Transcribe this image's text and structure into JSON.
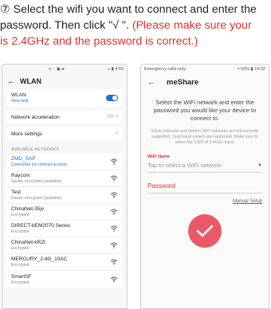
{
  "instruction": {
    "line1": "⑦ Select the wifi you want to connect and enter the",
    "line2_black": "password. Then click \"√ \". ",
    "line2_red": "(Please make sure your",
    "line3_red": "is 2.4GHz and the password is correct.)"
  },
  "left_phone": {
    "status_left": "",
    "status_center": "≡ ∴ ▣ ●",
    "status_right": "◒ ▮ 4:59",
    "title": "WLAN",
    "wlan_label": "WLAN",
    "wlan_link": "View help",
    "network_accel_label": "Network acceleration",
    "network_accel_value": "On >",
    "more_settings_label": "More settings",
    "section_label": "AVAILABLE NETWORKS",
    "networks": [
      {
        "name": "ZMD_SAP",
        "status": "Connected (no Internet access)"
      },
      {
        "name": "Raycom",
        "status": "Saved, encrypted (available)"
      },
      {
        "name": "Test",
        "status": "Saved, encrypted (available)"
      },
      {
        "name": "ChinaNet-35jv",
        "status": "Encrypted"
      },
      {
        "name": "DIRECT-bEM2070 Series",
        "status": "Encrypted"
      },
      {
        "name": "ChinaNet-kRZt",
        "status": "Encrypted"
      },
      {
        "name": "MERCURY_2.4G_10AC",
        "status": "Encrypted"
      },
      {
        "name": "SmartSF",
        "status": "Encrypted"
      }
    ]
  },
  "right_phone": {
    "status_left": "Emergency calls only",
    "status_right": "≈ 62% ▮ 14:32",
    "title": "meShare",
    "instruction": "Select the WiFi network and enter the password you would like your device to connect to.",
    "note": "5GHz networks and hidden WiFi networks are not currently supported. Dual band routers are supported. Make sure to select the SSID of 2.4GHz band.",
    "wifi_label": "WiFi Name",
    "wifi_placeholder": "Tap to select a WiFi network",
    "password_label": "Password",
    "manual_setup": "Manual Setup"
  },
  "colors": {
    "accent_red": "#e0312b",
    "toggle_blue": "#1e6fd9",
    "check_pink": "#ea5a66"
  }
}
